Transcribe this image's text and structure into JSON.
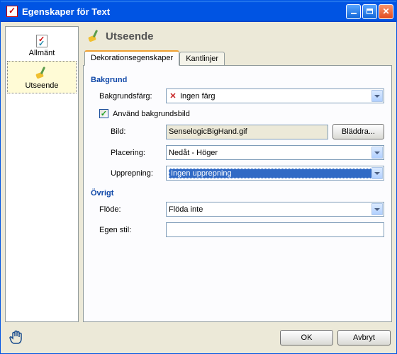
{
  "window": {
    "title": "Egenskaper för Text"
  },
  "sidebar": {
    "items": [
      {
        "label": "Allmänt"
      },
      {
        "label": "Utseende"
      }
    ]
  },
  "header": {
    "title": "Utseende"
  },
  "tabs": [
    {
      "label": "Dekorationsegenskaper"
    },
    {
      "label": "Kantlinjer"
    }
  ],
  "groups": {
    "background": {
      "title": "Bakgrund",
      "bgcolor_label": "Bakgrundsfärg:",
      "bgcolor_value": "Ingen färg",
      "use_bgimage_label": "Använd bakgrundsbild",
      "use_bgimage_checked": true,
      "image_label": "Bild:",
      "image_value": "SenselogicBigHand.gif",
      "browse_label": "Bläddra...",
      "position_label": "Placering:",
      "position_value": "Nedåt - Höger",
      "repeat_label": "Upprepning:",
      "repeat_value": "Ingen upprepning"
    },
    "other": {
      "title": "Övrigt",
      "flow_label": "Flöde:",
      "flow_value": "Flöda inte",
      "ownstyle_label": "Egen stil:",
      "ownstyle_value": ""
    }
  },
  "footer": {
    "ok": "OK",
    "cancel": "Avbryt"
  }
}
